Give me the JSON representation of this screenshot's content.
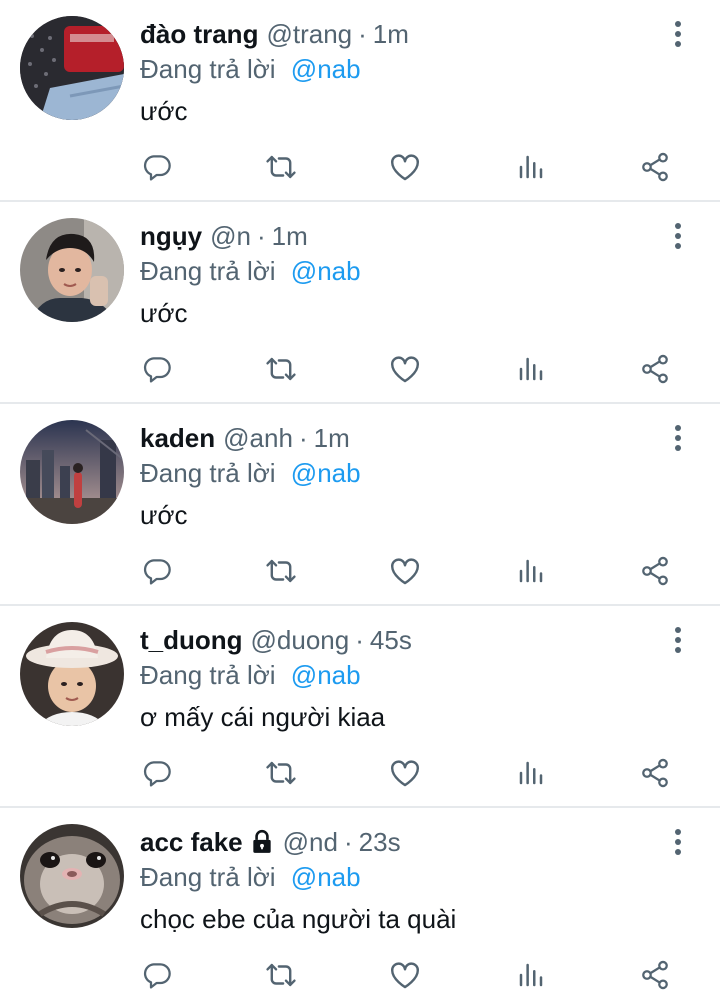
{
  "reply_prefix": "Đang trả lời",
  "tweets": [
    {
      "name": "đào trang",
      "handle": "@trang",
      "separator": "·",
      "time": "1m",
      "locked": false,
      "reply_to": "@nab",
      "text": "ước",
      "avatar": "avatar-dao-trang"
    },
    {
      "name": "ngụy",
      "handle": "@n",
      "separator": "·",
      "time": "1m",
      "locked": false,
      "reply_to": "@nab",
      "text": "ước",
      "avatar": "avatar-nguy"
    },
    {
      "name": "kaden",
      "handle": "@anh",
      "separator": "·",
      "time": "1m",
      "locked": false,
      "reply_to": "@nab",
      "text": "ước",
      "avatar": "avatar-kaden"
    },
    {
      "name": "t_duong",
      "handle": "@duong",
      "separator": "·",
      "time": "45s",
      "locked": false,
      "reply_to": "@nab",
      "text": "ơ mấy cái người kiaa",
      "avatar": "avatar-t-duong"
    },
    {
      "name": "acc fake",
      "handle": "@nd",
      "separator": "·",
      "time": "23s",
      "locked": true,
      "reply_to": "@nab",
      "text": "chọc ebe của người ta quài",
      "avatar": "avatar-acc-fake"
    }
  ],
  "icons": {
    "more": "more-vertical-icon",
    "reply": "reply-icon",
    "retweet": "retweet-icon",
    "like": "like-icon",
    "views": "views-icon",
    "share": "share-icon",
    "lock": "lock-icon"
  },
  "colors": {
    "text": "#0f1419",
    "secondary": "#536471",
    "accent": "#1d9bf0",
    "divider": "#e6e9ec"
  }
}
